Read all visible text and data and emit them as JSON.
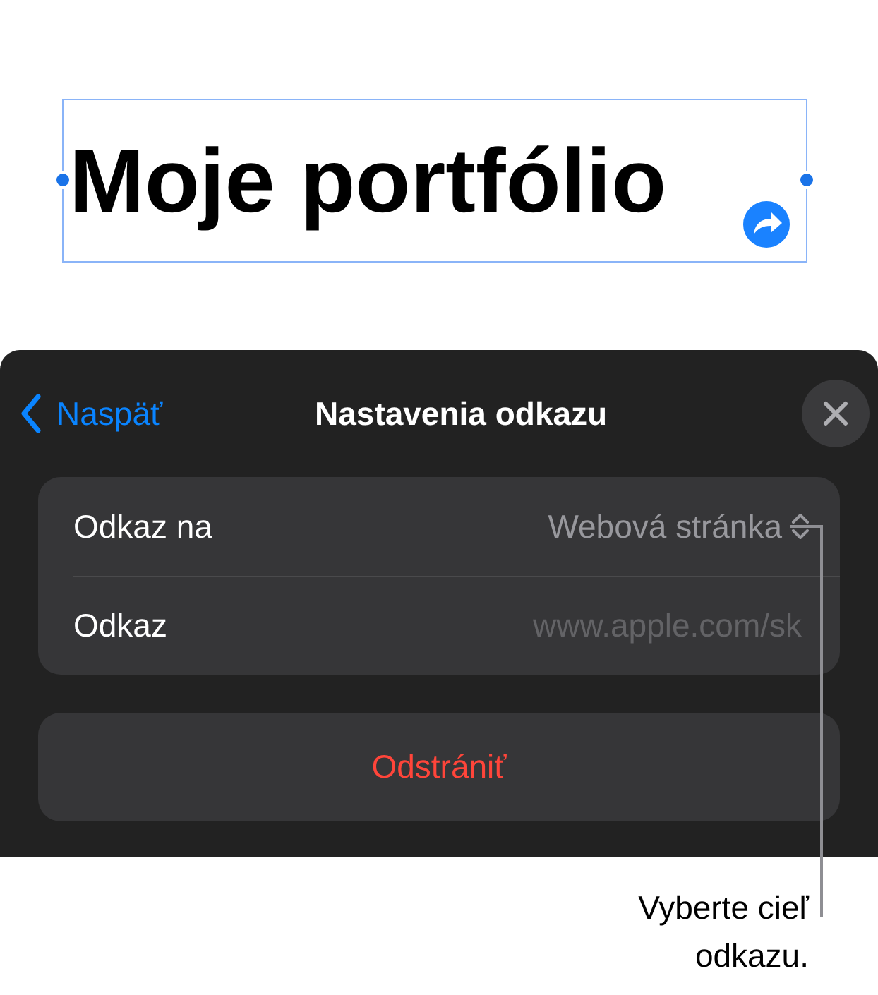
{
  "canvas": {
    "title": "Moje portfólio"
  },
  "panel": {
    "back": "Naspäť",
    "title": "Nastavenia odkazu",
    "rows": [
      {
        "kind": "picker",
        "label": "Odkaz na",
        "value": "Webová stránka"
      },
      {
        "kind": "field",
        "label": "Odkaz",
        "placeholder": "www.apple.com/sk"
      }
    ],
    "delete": "Odstrániť"
  },
  "callout": "Vyberte cieľ odkazu."
}
